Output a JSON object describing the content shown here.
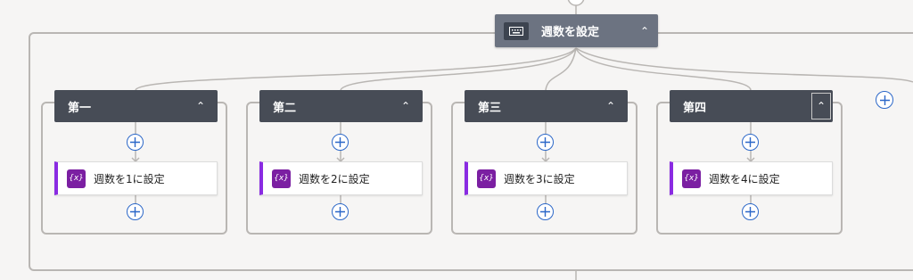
{
  "switch": {
    "title": "週数を設定",
    "collapse_icon": "chevron-up-icon",
    "type_icon": "keyboard-icon"
  },
  "cases": [
    {
      "label": "第一",
      "action": "週数を1に設定"
    },
    {
      "label": "第二",
      "action": "週数を2に設定"
    },
    {
      "label": "第三",
      "action": "週数を3に設定"
    },
    {
      "label": "第四",
      "action": "週数を4に設定"
    }
  ],
  "variable_icon_text": "{x}",
  "colors": {
    "switch_header": "#6c7381",
    "case_header": "#474c56",
    "action_accent": "#8a2be2",
    "add_button": "#2b67c8",
    "connector": "#b9b6b3"
  }
}
